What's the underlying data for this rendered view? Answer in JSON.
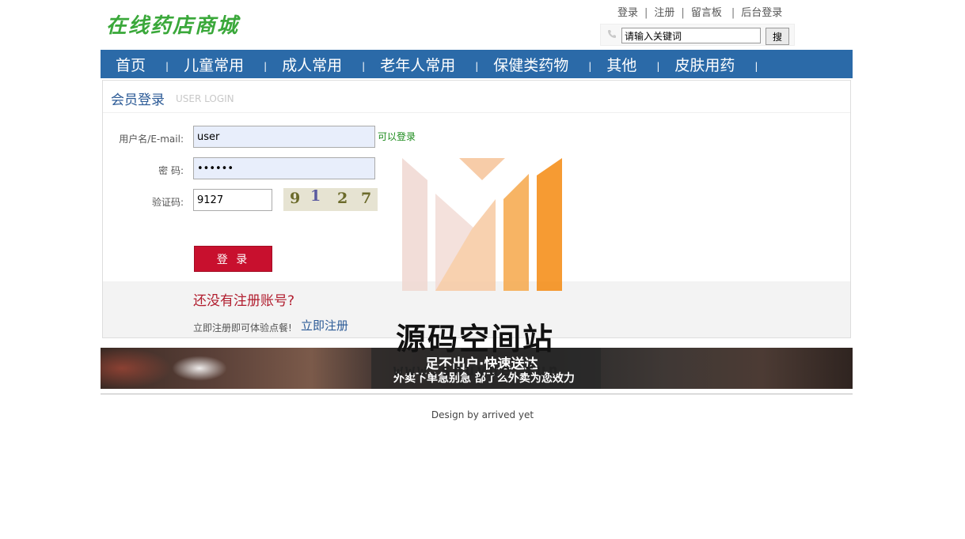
{
  "site": {
    "logo_text": "在线药店商城"
  },
  "top_links": [
    {
      "label": "登录"
    },
    {
      "label": "注册"
    },
    {
      "label": "留言板"
    },
    {
      "label": "后台登录"
    }
  ],
  "top_links_separator": "|",
  "search": {
    "value": "请输入关键词",
    "button": "搜"
  },
  "nav": {
    "items": [
      {
        "label": "首页"
      },
      {
        "label": "儿童常用"
      },
      {
        "label": "成人常用"
      },
      {
        "label": "老年人常用"
      },
      {
        "label": "保健类药物"
      },
      {
        "label": "其他"
      },
      {
        "label": "皮肤用药"
      }
    ],
    "separator": "|"
  },
  "login": {
    "title": "会员登录",
    "subtitle": "USER LOGIN",
    "username_label": "用户名/E-mail:",
    "username_value": "user",
    "username_status": "可以登录",
    "password_label": "密  码:",
    "password_value": "••••••",
    "captcha_label": "验证码:",
    "captcha_value": "9127",
    "captcha_chars": [
      "9",
      "1",
      "2",
      "7"
    ],
    "submit": "登 录"
  },
  "register": {
    "question": "还没有注册账号?",
    "note": "立即注册即可体验点餐!",
    "link": "立即注册"
  },
  "banner": {
    "headline": "足不出户·快速送达",
    "tagline": "外卖下单急别急 部了么外卖为您效力"
  },
  "footer": {
    "text": "Design by arrived yet"
  },
  "watermark": {
    "text": "源码空间站",
    "url": "www.shuyue.fun"
  },
  "colors": {
    "nav_bg": "#2b6aa8",
    "logo": "#3aa83a",
    "login_button": "#c8102e",
    "link_blue": "#2b5a96",
    "status_green": "#1a8a1a"
  }
}
